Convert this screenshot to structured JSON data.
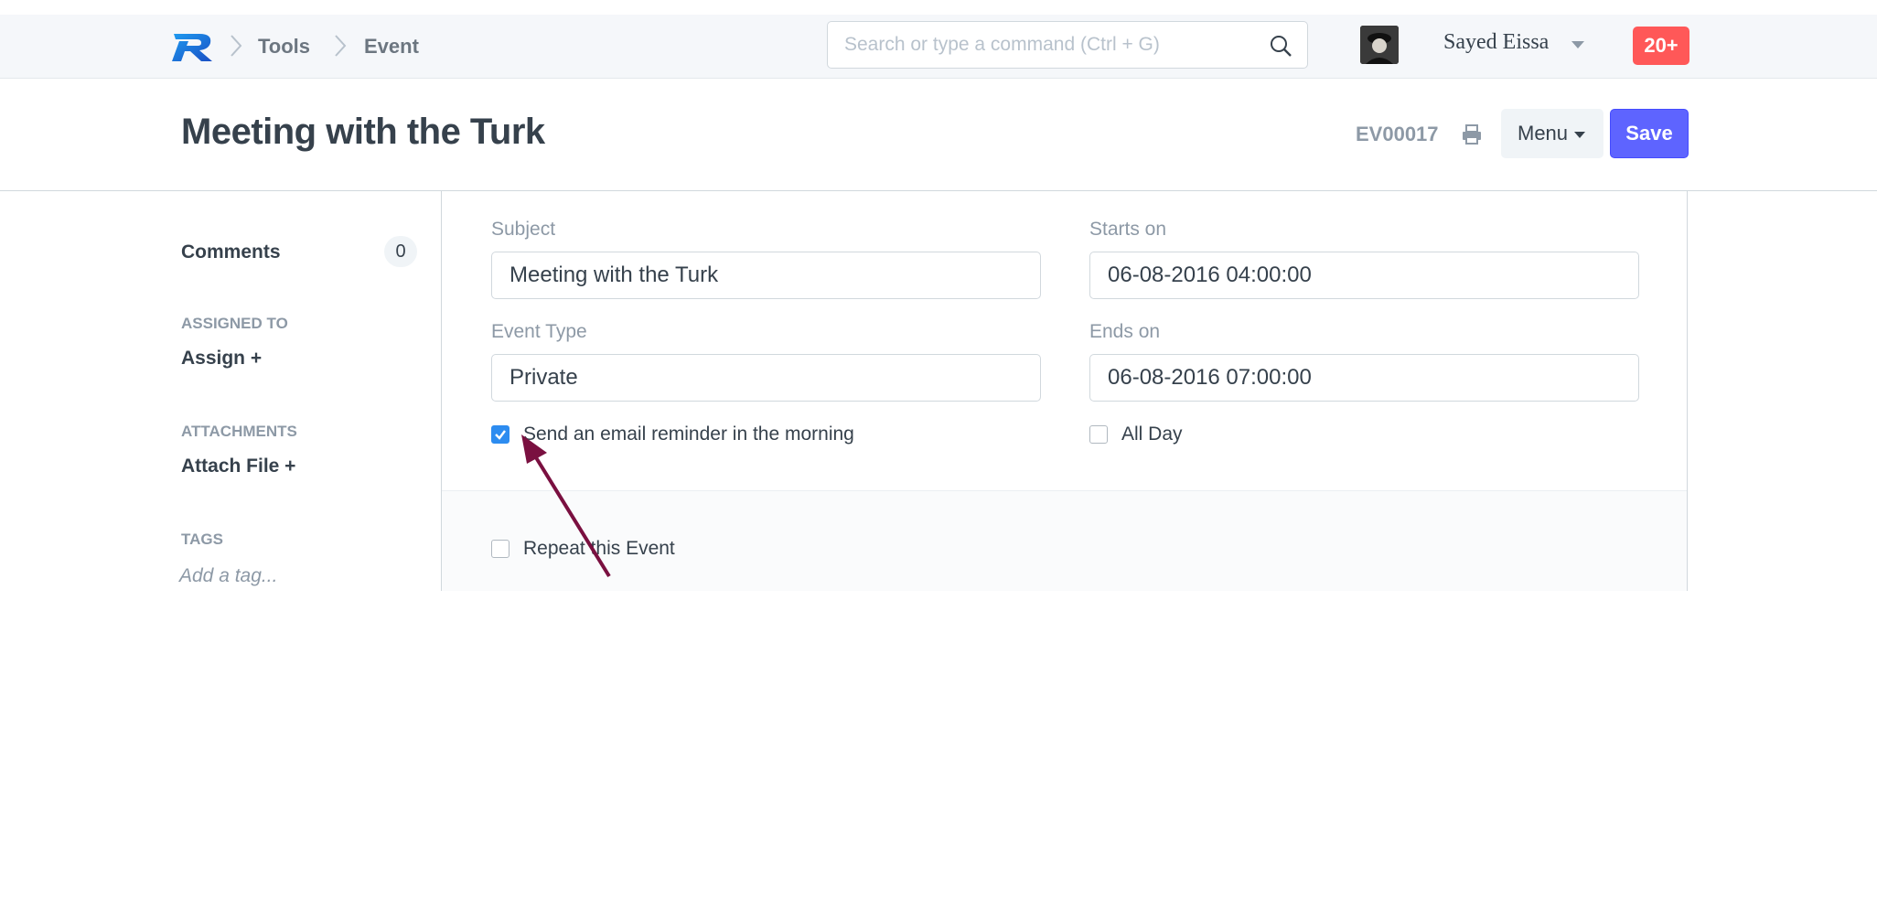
{
  "navbar": {
    "breadcrumbs": [
      "Tools",
      "Event"
    ],
    "search_placeholder": "Search or type a command (Ctrl + G)",
    "user_name": "Sayed Eissa",
    "notification_count": "20+"
  },
  "page": {
    "title": "Meeting with the Turk",
    "doc_id": "EV00017",
    "menu_label": "Menu",
    "save_label": "Save"
  },
  "sidebar": {
    "comments_label": "Comments",
    "comments_count": "0",
    "assigned_to_label": "ASSIGNED TO",
    "assign_action": "Assign +",
    "attachments_label": "ATTACHMENTS",
    "attach_action": "Attach File +",
    "tags_label": "TAGS",
    "tag_placeholder": "Add a tag..."
  },
  "form": {
    "subject_label": "Subject",
    "subject_value": "Meeting with the Turk",
    "event_type_label": "Event Type",
    "event_type_value": "Private",
    "starts_on_label": "Starts on",
    "starts_on_value": "06-08-2016 04:00:00",
    "ends_on_label": "Ends on",
    "ends_on_value": "06-08-2016 07:00:00",
    "email_reminder_label": "Send an email reminder in the morning",
    "email_reminder_checked": true,
    "all_day_label": "All Day",
    "all_day_checked": false,
    "repeat_label": "Repeat this Event",
    "repeat_checked": false
  },
  "colors": {
    "accent": "#5e64ff",
    "checkbox_checked": "#2d8cf0",
    "notification": "#ff5858",
    "annotation_arrow": "#7a1040"
  }
}
